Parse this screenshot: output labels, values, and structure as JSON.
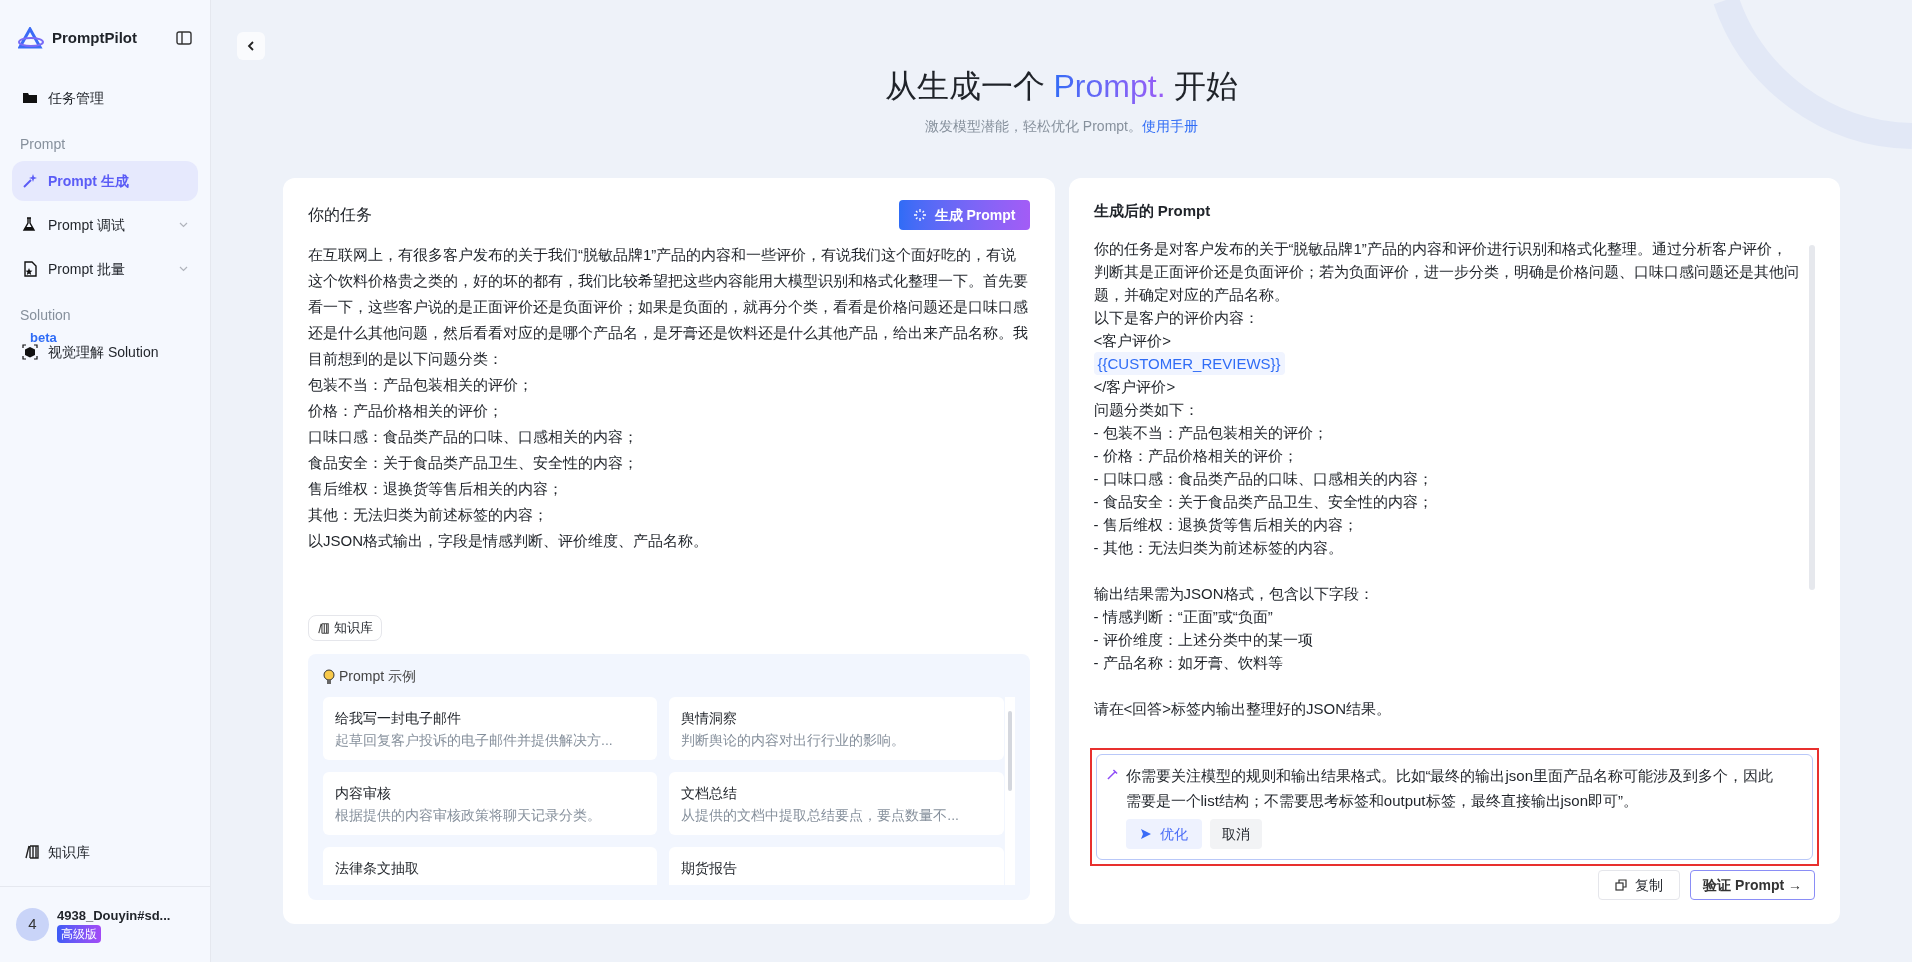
{
  "sidebar": {
    "brand": "PromptPilot",
    "items": [
      {
        "kind": "item",
        "label": "任务管理",
        "selected": false,
        "expandable": false
      },
      {
        "kind": "section",
        "label": "Prompt"
      },
      {
        "kind": "item",
        "label": "Prompt 生成",
        "selected": true,
        "expandable": false
      },
      {
        "kind": "item",
        "label": "Prompt 调试",
        "selected": false,
        "expandable": true
      },
      {
        "kind": "item",
        "label": "Prompt 批量",
        "selected": false,
        "expandable": true
      },
      {
        "kind": "section",
        "label": "Solution"
      },
      {
        "kind": "item",
        "label": "视觉理解 Solution",
        "selected": false,
        "expandable": false,
        "badge": "beta"
      }
    ],
    "footer_link": "知识库",
    "user": {
      "avatar": "4",
      "name": "4938_Douyin#sd...",
      "plan": "高级版"
    }
  },
  "header": {
    "title_before": "从生成一个 ",
    "title_highlight": "Prompt.",
    "title_after": " 开始",
    "subtitle": "激发模型潜能，轻松优化 Prompt。",
    "subtitle_link": "使用手册"
  },
  "task": {
    "title": "你的任务",
    "generate_button": "生成 Prompt",
    "lines": [
      "在互联网上，有很多客户发布的关于我们“脱敏品牌1”产品的内容和一些评价，有说我们这个面好吃的，有说这个饮料价格贵之类的，好的坏的都有，我们比较希望把这些内容能用大模型识别和格式化整理一下。首先要看一下，这些客户说的是正面评价还是负面评价；如果是负面的，就再分个类，看看是价格问题还是口味口感还是什么其他问题，然后看看对应的是哪个产品名，是牙膏还是饮料还是什么其他产品，给出来产品名称。我目前想到的是以下问题分类：",
      "包装不当：产品包装相关的评价；",
      "价格：产品价格相关的评价；",
      "口味口感：食品类产品的口味、口感相关的内容；",
      "食品安全：关于食品类产品卫生、安全性的内容；",
      "售后维权：退换货等售后相关的内容；",
      "其他：无法归类为前述标签的内容；",
      "以JSON格式输出，字段是情感判断、评价维度、产品名称。"
    ],
    "knowledge_chip": "知识库",
    "examples_title": "Prompt 示例",
    "examples": [
      {
        "title": "给我写一封电子邮件",
        "description": "起草回复客户投诉的电子邮件并提供解决方..."
      },
      {
        "title": "舆情洞察",
        "description": "判断舆论的内容对出行行业的影响。"
      },
      {
        "title": "内容审核",
        "description": "根据提供的内容审核政策将聊天记录分类。"
      },
      {
        "title": "文档总结",
        "description": "从提供的文档中提取总结要点，要点数量不..."
      },
      {
        "title": "法律条文抽取"
      },
      {
        "title": "期货报告"
      }
    ]
  },
  "result": {
    "title": "生成后的 Prompt",
    "lines": [
      {
        "kind": "text",
        "text": "你的任务是对客户发布的关于“脱敏品牌1”产品的内容和评价进行识别和格式化整理。通过分析客户评价，判断其是正面评价还是负面评价；若为负面评价，进一步分类，明确是价格问题、口味口感问题还是其他问题，并确定对应的产品名称。"
      },
      {
        "kind": "text",
        "text": "以下是客户的评价内容："
      },
      {
        "kind": "text",
        "text": "<客户评价>"
      },
      {
        "kind": "variable",
        "text": "{{CUSTOMER_REVIEWS}}"
      },
      {
        "kind": "text",
        "text": "</客户评价>"
      },
      {
        "kind": "text",
        "text": "问题分类如下："
      },
      {
        "kind": "text",
        "text": "- 包装不当：产品包装相关的评价；"
      },
      {
        "kind": "text",
        "text": "- 价格：产品价格相关的评价；"
      },
      {
        "kind": "text",
        "text": "- 口味口感：食品类产品的口味、口感相关的内容；"
      },
      {
        "kind": "text",
        "text": "- 食品安全：关于食品类产品卫生、安全性的内容；"
      },
      {
        "kind": "text",
        "text": "- 售后维权：退换货等售后相关的内容；"
      },
      {
        "kind": "text",
        "text": "- 其他：无法归类为前述标签的内容。"
      },
      {
        "kind": "blank"
      },
      {
        "kind": "text",
        "text": "输出结果需为JSON格式，包含以下字段："
      },
      {
        "kind": "text",
        "text": "- 情感判断：“正面”或“负面”"
      },
      {
        "kind": "text",
        "text": "- 评价维度：上述分类中的某一项"
      },
      {
        "kind": "text",
        "text": "- 产品名称：如牙膏、饮料等"
      },
      {
        "kind": "blank"
      },
      {
        "kind": "text",
        "text": "请在<回答>标签内输出整理好的JSON结果。"
      }
    ],
    "feedback": {
      "text": "你需要关注模型的规则和输出结果格式。比如“最终的输出json里面产品名称可能涉及到多个，因此需要是一个list结构；不需要思考标签和output标签，最终直接输出json即可”。",
      "optimize_button": "优化",
      "cancel_button": "取消"
    },
    "copy_button": "复制",
    "verify_button": "验证 Prompt →"
  }
}
